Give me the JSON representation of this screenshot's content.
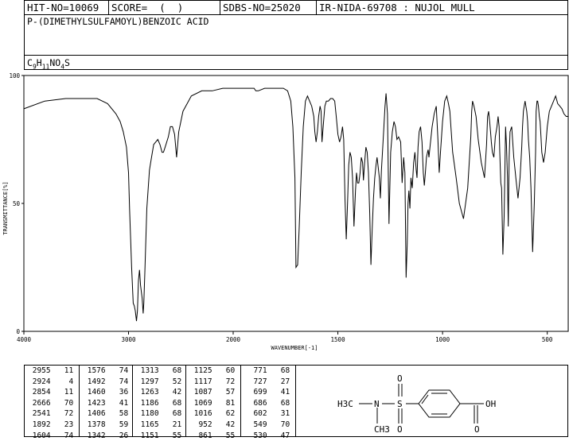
{
  "header": {
    "hit_no": "HIT-NO=10069",
    "score": "SCORE=  (  )",
    "sdbs_no": "SDBS-NO=25020",
    "ir_id": "IR-NIDA-69708 : NUJOL MULL",
    "compound": "P-(DIMETHYLSULFAMOYL)BENZOIC ACID",
    "formula": {
      "c": "C",
      "c_n": "9",
      "h": "H",
      "h_n": "11",
      "n": "N",
      "o": "O",
      "o_n": "4",
      "s": "S"
    }
  },
  "chart_data": {
    "type": "line",
    "title": "",
    "xlabel": "WAVENUMBER[-1]",
    "ylabel": "TRANSMITTANCE[%]",
    "xlim": [
      4000,
      400
    ],
    "ylim": [
      0,
      100
    ],
    "x_ticks": [
      "4000",
      "3000",
      "2000",
      "1500",
      "1000",
      "500"
    ],
    "y_ticks": [
      "0",
      "50",
      "100"
    ],
    "series": [
      {
        "x": [
          4000,
          3800,
          3600,
          3400,
          3300,
          3200,
          3120,
          3080,
          3050,
          3020,
          3000,
          2990,
          2970,
          2955,
          2945,
          2935,
          2924,
          2915,
          2905,
          2895,
          2885,
          2870,
          2860,
          2854,
          2845,
          2825,
          2800,
          2780,
          2760,
          2740,
          2720,
          2700,
          2680,
          2666,
          2650,
          2620,
          2600,
          2580,
          2560,
          2541,
          2520,
          2480,
          2400,
          2300,
          2200,
          2100,
          2050,
          2000,
          1950,
          1900,
          1892,
          1880,
          1850,
          1820,
          1800,
          1780,
          1760,
          1740,
          1725,
          1715,
          1705,
          1700,
          1692,
          1685,
          1675,
          1665,
          1655,
          1645,
          1635,
          1625,
          1615,
          1610,
          1604,
          1598,
          1592,
          1585,
          1580,
          1576,
          1570,
          1562,
          1555,
          1545,
          1535,
          1525,
          1515,
          1508,
          1500,
          1492,
          1485,
          1478,
          1472,
          1466,
          1460,
          1454,
          1448,
          1442,
          1436,
          1430,
          1423,
          1416,
          1411,
          1406,
          1400,
          1394,
          1388,
          1382,
          1378,
          1372,
          1366,
          1360,
          1354,
          1348,
          1342,
          1336,
          1330,
          1324,
          1318,
          1313,
          1307,
          1302,
          1297,
          1292,
          1287,
          1280,
          1275,
          1270,
          1263,
          1256,
          1248,
          1240,
          1232,
          1225,
          1218,
          1210,
          1200,
          1193,
          1186,
          1180,
          1174,
          1169,
          1165,
          1161,
          1156,
          1151,
          1145,
          1138,
          1132,
          1126,
          1122,
          1117,
          1112,
          1105,
          1098,
          1092,
          1087,
          1082,
          1077,
          1072,
          1069,
          1065,
          1060,
          1050,
          1040,
          1030,
          1022,
          1016,
          1010,
          1000,
          990,
          980,
          972,
          965,
          960,
          952,
          945,
          935,
          920,
          900,
          880,
          865,
          861,
          857,
          850,
          840,
          830,
          815,
          800,
          790,
          785,
          780,
          775,
          771,
          767,
          762,
          755,
          748,
          740,
          735,
          730,
          727,
          722,
          718,
          712,
          706,
          702,
          699,
          695,
          690,
          686,
          682,
          678,
          670,
          660,
          650,
          640,
          630,
          622,
          618,
          614,
          610,
          606,
          602,
          598,
          594,
          590,
          584,
          578,
          570,
          562,
          556,
          553,
          549,
          546,
          542,
          538,
          534,
          530,
          526,
          522,
          518,
          510,
          500,
          490,
          480,
          470,
          460,
          450,
          440,
          430,
          420,
          410,
          400
        ],
        "y": [
          87,
          90,
          91,
          91,
          91,
          89,
          85,
          82,
          78,
          72,
          62,
          48,
          25,
          11,
          10,
          8,
          4,
          8,
          20,
          24,
          18,
          13,
          7,
          11,
          22,
          48,
          63,
          68,
          73,
          74,
          75,
          73,
          70,
          70,
          72,
          76,
          80,
          80,
          77,
          68,
          78,
          86,
          92,
          94,
          94,
          95,
          95,
          95,
          95,
          95,
          94,
          94,
          95,
          95,
          95,
          95,
          95,
          94,
          90,
          80,
          60,
          25,
          26,
          40,
          62,
          80,
          90,
          92,
          90,
          88,
          84,
          78,
          74,
          78,
          84,
          88,
          86,
          74,
          80,
          88,
          90,
          90,
          91,
          91,
          90,
          84,
          77,
          74,
          76,
          80,
          75,
          52,
          36,
          50,
          65,
          70,
          68,
          60,
          41,
          55,
          62,
          58,
          58,
          62,
          68,
          66,
          59,
          66,
          72,
          70,
          62,
          46,
          26,
          40,
          52,
          60,
          65,
          68,
          64,
          60,
          52,
          63,
          70,
          80,
          88,
          93,
          85,
          42,
          70,
          78,
          82,
          80,
          75,
          76,
          74,
          58,
          68,
          62,
          21,
          34,
          50,
          55,
          48,
          60,
          56,
          66,
          70,
          63,
          60,
          72,
          78,
          80,
          74,
          62,
          57,
          62,
          68,
          70,
          71,
          68,
          72,
          80,
          85,
          88,
          75,
          62,
          70,
          82,
          90,
          92,
          89,
          86,
          80,
          70,
          66,
          60,
          50,
          44,
          56,
          76,
          86,
          90,
          88,
          84,
          75,
          66,
          60,
          73,
          84,
          86,
          82,
          78,
          74,
          70,
          68,
          76,
          80,
          84,
          80,
          70,
          58,
          56,
          30,
          45,
          64,
          80,
          73,
          60,
          41,
          68,
          78,
          80,
          68,
          60,
          52,
          60,
          72,
          80,
          86,
          88,
          90,
          88,
          86,
          82,
          75,
          68,
          56,
          31,
          50,
          70,
          86,
          90,
          90,
          88,
          84,
          82,
          76,
          70,
          68,
          66,
          70,
          80,
          86,
          88,
          90,
          92,
          89,
          88,
          87,
          85,
          84,
          84
        ]
      }
    ],
    "peaks": [
      [
        [
          "2955",
          "11"
        ],
        [
          "2924",
          "4"
        ],
        [
          "2854",
          "11"
        ],
        [
          "2666",
          "70"
        ],
        [
          "2541",
          "72"
        ],
        [
          "1892",
          "23"
        ],
        [
          "1604",
          "74"
        ]
      ],
      [
        [
          "1576",
          "74"
        ],
        [
          "1492",
          "74"
        ],
        [
          "1460",
          "36"
        ],
        [
          "1423",
          "41"
        ],
        [
          "1406",
          "58"
        ],
        [
          "1378",
          "59"
        ],
        [
          "1342",
          "26"
        ]
      ],
      [
        [
          "1313",
          "68"
        ],
        [
          "1297",
          "52"
        ],
        [
          "1263",
          "42"
        ],
        [
          "1186",
          "68"
        ],
        [
          "1180",
          "68"
        ],
        [
          "1165",
          "21"
        ],
        [
          "1151",
          "55"
        ]
      ],
      [
        [
          "1125",
          "60"
        ],
        [
          "1117",
          "72"
        ],
        [
          "1087",
          "57"
        ],
        [
          "1069",
          "81"
        ],
        [
          "1016",
          "62"
        ],
        [
          "952",
          "42"
        ],
        [
          "861",
          "55"
        ]
      ],
      [
        [
          "771",
          "68"
        ],
        [
          "727",
          "27"
        ],
        [
          "699",
          "41"
        ],
        [
          "686",
          "68"
        ],
        [
          "602",
          "31"
        ],
        [
          "549",
          "70"
        ],
        [
          "530",
          "47"
        ]
      ]
    ]
  },
  "structure": {
    "left_group": "H3C",
    "n_label": "N",
    "n_methyl": "CH3",
    "s_label": "S",
    "o_top": "O",
    "o_bottom": "O",
    "acid_o": "O",
    "acid_oh": "OH"
  }
}
